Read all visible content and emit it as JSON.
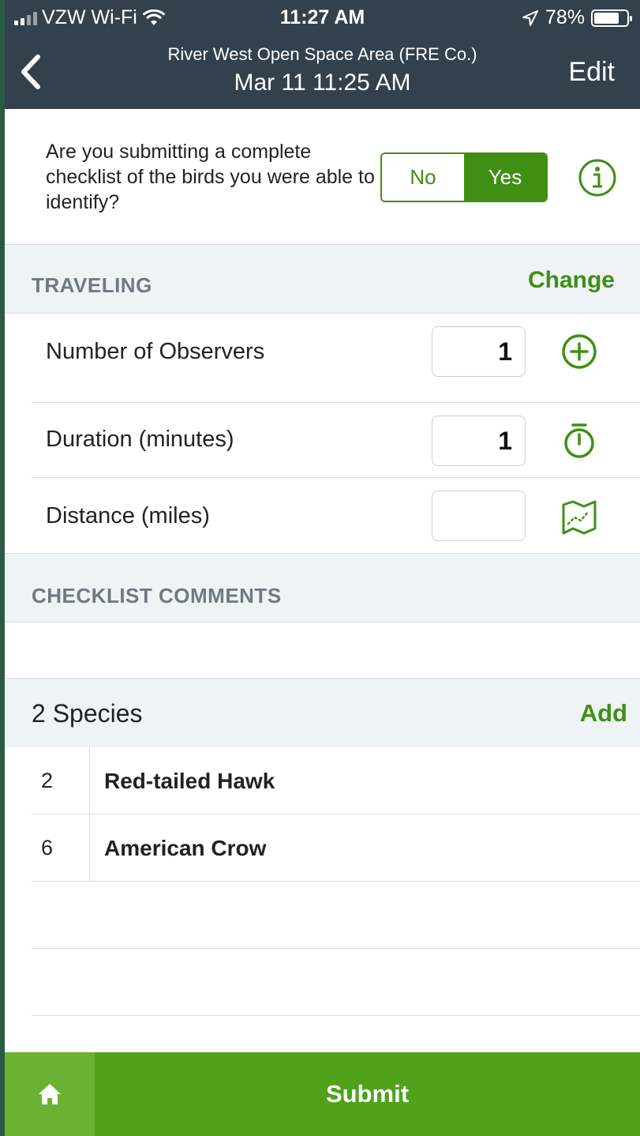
{
  "status_bar": {
    "carrier": "VZW Wi-Fi",
    "time": "11:27 AM",
    "battery": "78%",
    "battery_level": 0.78,
    "icons": [
      "signal-bars-icon",
      "wifi-icon",
      "location-arrow-icon",
      "battery-icon"
    ]
  },
  "nav": {
    "title": "River West Open Space Area (FRE Co.)",
    "subtitle": "Mar 11 11:25 AM",
    "back_icon": "chevron-left-icon",
    "edit_label": "Edit"
  },
  "complete_checklist": {
    "question": "Are you submitting a complete checklist of the birds you were able to identify?",
    "options": [
      "No",
      "Yes"
    ],
    "selected": "Yes",
    "info_icon": "info-circle-icon"
  },
  "protocol": {
    "title": "TRAVELING",
    "action": "Change"
  },
  "fields": [
    {
      "label": "Number of Observers",
      "value": "1",
      "icon": "plus-circle-icon"
    },
    {
      "label": "Duration (minutes)",
      "value": "1",
      "icon": "stopwatch-icon"
    },
    {
      "label": "Distance (miles)",
      "value": "",
      "icon": "map-track-icon"
    }
  ],
  "comments": {
    "title": "CHECKLIST COMMENTS",
    "value": ""
  },
  "species": {
    "count_label": "2 Species",
    "add_label": "Add",
    "items": [
      {
        "count": "2",
        "name": "Red-tailed Hawk"
      },
      {
        "count": "6",
        "name": "American Crow"
      }
    ]
  },
  "bottom_bar": {
    "home_icon": "home-icon",
    "submit_label": "Submit"
  },
  "colors": {
    "header_bg": "#33414e",
    "accent_green": "#3f8f14",
    "submit_green": "#4fa21a",
    "home_green": "#6bb233",
    "section_bg": "#eef3f6"
  }
}
